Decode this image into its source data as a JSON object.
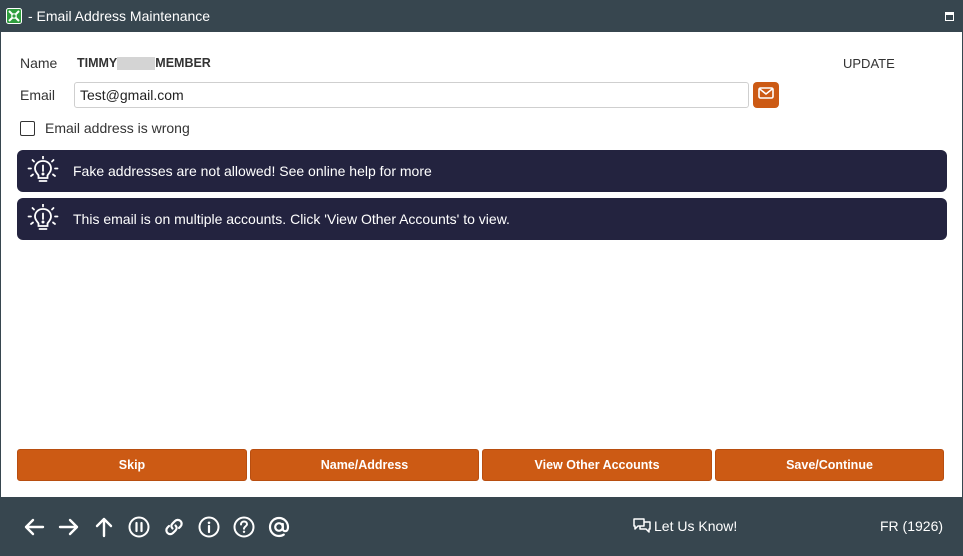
{
  "window": {
    "title": "- Email Address Maintenance",
    "app_icon": "app-logo-icon",
    "restore_icon": "window-restore-icon"
  },
  "form": {
    "name_label": "Name",
    "name_first": "TIMMY",
    "name_last": "MEMBER",
    "mode": "UPDATE",
    "email_label": "Email",
    "email_value": "Test@gmail.com",
    "email_button_icon": "envelope-icon",
    "checkbox_label": "Email address is wrong",
    "checkbox_checked": false
  },
  "alerts": [
    {
      "icon": "lightbulb-icon",
      "text": "Fake addresses are not allowed! See online help for more"
    },
    {
      "icon": "lightbulb-icon",
      "text": "This email is on multiple accounts. Click 'View Other Accounts' to view."
    }
  ],
  "buttons": {
    "skip": "Skip",
    "name_address": "Name/Address",
    "view_other_accounts": "View Other Accounts",
    "save_continue": "Save/Continue"
  },
  "footer": {
    "icons": [
      "arrow-left-icon",
      "arrow-right-icon",
      "arrow-up-icon",
      "pause-icon",
      "link-icon",
      "info-icon",
      "help-icon",
      "at-icon"
    ],
    "let_us_know": "Let Us Know!",
    "status": "FR (1926)"
  },
  "colors": {
    "titlebar": "#37464f",
    "accent": "#cc5a14",
    "alert_bg": "#23233f"
  }
}
